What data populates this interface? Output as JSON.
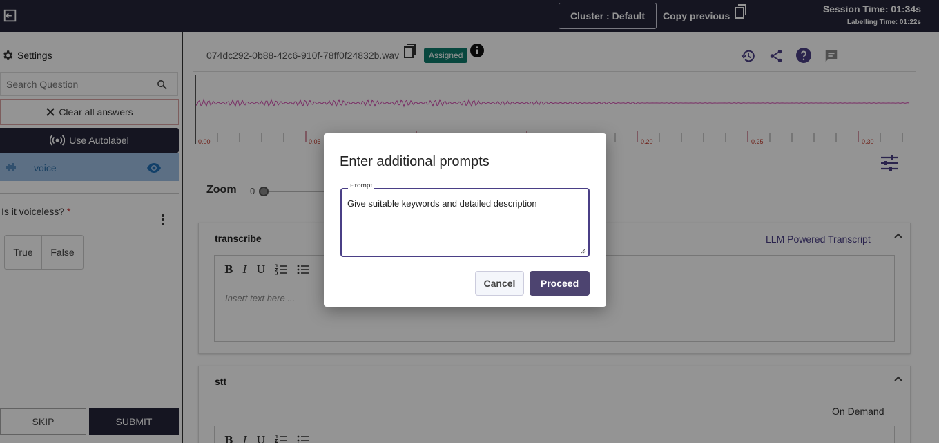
{
  "topbar": {
    "cluster_label": "Cluster : Default",
    "copy_previous_label": "Copy previous",
    "session_time": "Session Time: 01:34s",
    "labelling_time": "Labelling Time: 01:22s"
  },
  "sidebar": {
    "settings_label": "Settings",
    "search_placeholder": "Search Question",
    "clear_label": "Clear all answers",
    "autolabel_label": "Use Autolabel",
    "voice_label": "voice",
    "question": "Is it voiceless?",
    "required_mark": "*",
    "options": [
      "True",
      "False"
    ],
    "skip_label": "SKIP",
    "submit_label": "SUBMIT"
  },
  "main": {
    "filename": "074dc292-0b88-42c6-910f-78ff0f24832b.wav",
    "status_badge": "Assigned",
    "timeline_labels": [
      "0.00",
      "0.05",
      "0.20",
      "0.25",
      "0.30"
    ],
    "zoom_label": "Zoom",
    "zoom_value": "0",
    "transcribe": {
      "title": "transcribe",
      "tag": "LLM Powered Transcript",
      "toolbar": [
        "B",
        "I",
        "U"
      ],
      "placeholder": "Insert text here ..."
    },
    "stt": {
      "title": "stt",
      "tag": "On Demand",
      "toolbar": [
        "B",
        "I",
        "U"
      ]
    }
  },
  "dialog": {
    "title": "Enter additional prompts",
    "field_label": "Prompt",
    "prompt_value": "Give suitable keywords and detailed description",
    "cancel_label": "Cancel",
    "proceed_label": "Proceed"
  },
  "colors": {
    "topbar": "#25253a",
    "accent": "#4a3f86",
    "badge": "#0f7a6b",
    "waveform": "#d34fb0"
  }
}
